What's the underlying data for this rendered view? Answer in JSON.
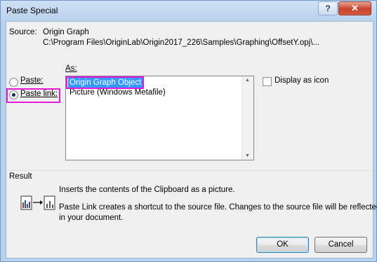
{
  "window": {
    "title": "Paste Special"
  },
  "titlebar": {
    "help_label": "?",
    "close_label": "✕"
  },
  "source": {
    "label": "Source:",
    "name": "Origin Graph",
    "path": "C:\\Program Files\\OriginLab\\Origin2017_226\\Samples\\Graphing\\OffsetY.opj\\..."
  },
  "paste_options": {
    "paste_label": "Paste:",
    "paste_link_label": "Paste link:",
    "selected": "paste_link"
  },
  "as_list": {
    "label": "As:",
    "items": [
      "Origin Graph Object",
      "Picture (Windows Metafile)"
    ],
    "selected_index": 0
  },
  "display_as_icon": {
    "label": "Display as icon",
    "checked": false
  },
  "result": {
    "label": "Result",
    "line1": "Inserts the contents of the Clipboard as a picture.",
    "line2": "Paste Link creates a shortcut to the source file. Changes to the source file will be reflected",
    "line3": "in your document."
  },
  "buttons": {
    "ok_label": "OK",
    "cancel_label": "Cancel"
  },
  "colors": {
    "highlight_box": "#e31bd9",
    "selection": "#3399ff",
    "title_gradient": "#b9d1ec"
  },
  "icons": [
    "help-icon",
    "close-icon",
    "radio-icon",
    "checkbox-icon",
    "paste-link-result-icon",
    "scroll-up-icon",
    "scroll-down-icon"
  ]
}
